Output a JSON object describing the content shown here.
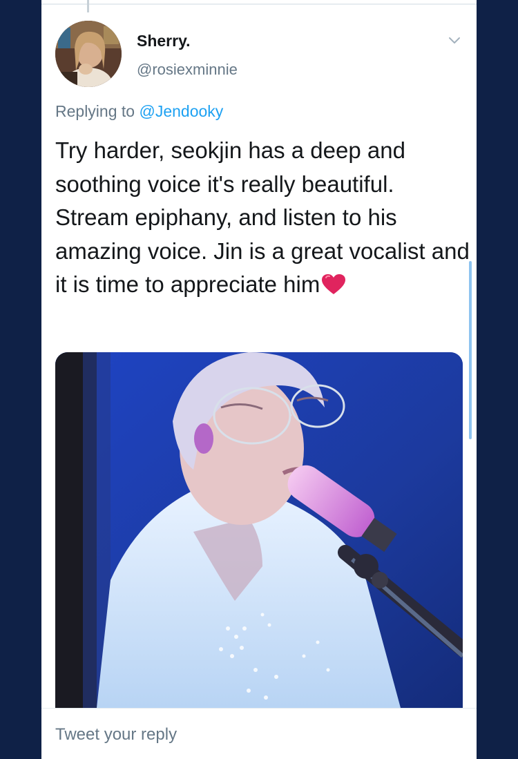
{
  "tweet": {
    "display_name": "Sherry.",
    "handle": "@rosiexminnie",
    "replying_prefix": "Replying to ",
    "replying_to": "@Jendooky",
    "text": "Try harder, seokjin has a deep and soothing voice it's really beautiful. Stream epiphany, and listen to his amazing voice. Jin is a great vocalist and it is time to appreciate him",
    "emoji": "heart"
  },
  "reply": {
    "placeholder": "Tweet your reply"
  },
  "colors": {
    "frame": "#0f2147",
    "link": "#1da1f2",
    "secondary_text": "#657786",
    "heart": "#e0245e"
  }
}
